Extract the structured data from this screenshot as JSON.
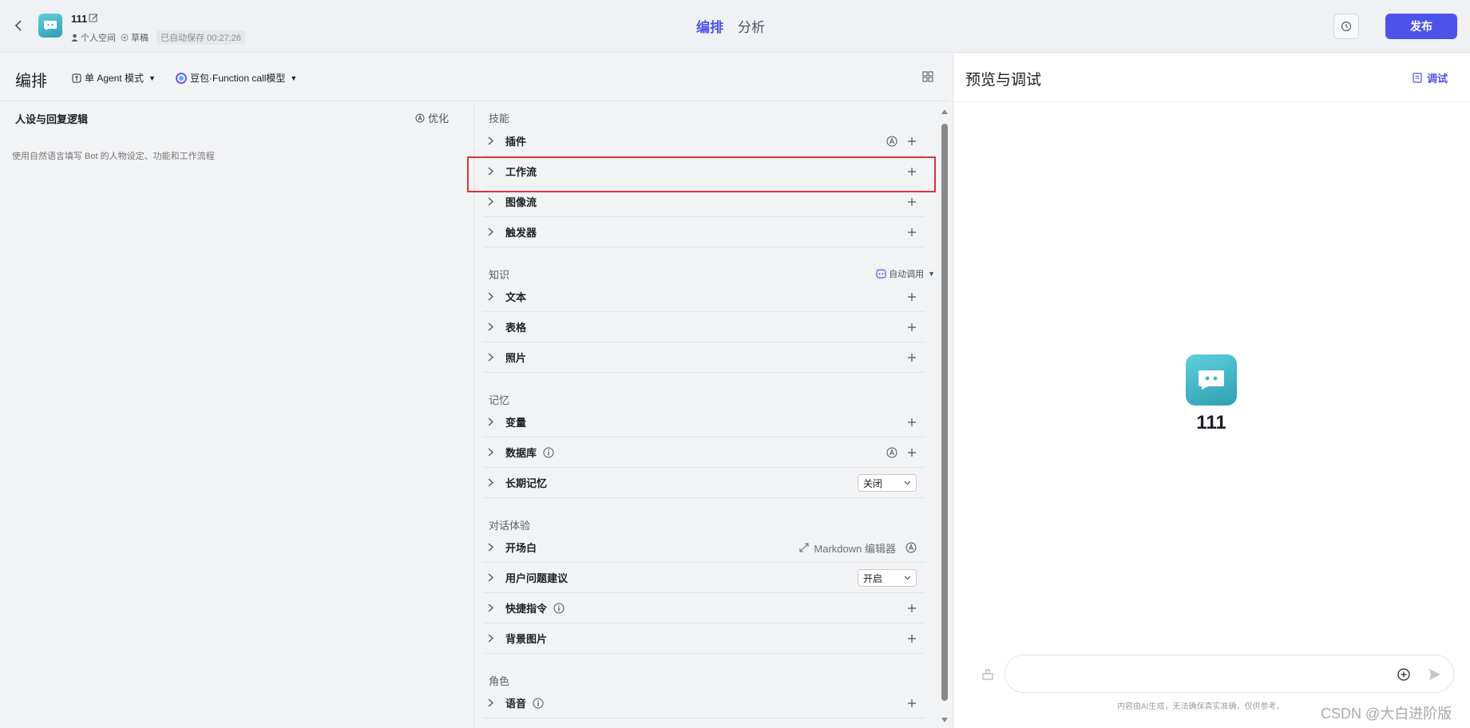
{
  "header": {
    "bot_name": "111",
    "space": "个人空间",
    "draft": "草稿",
    "autosave": "已自动保存 00:27:26",
    "tabs": [
      {
        "label": "编排",
        "active": true
      },
      {
        "label": "分析",
        "active": false
      }
    ],
    "publish_label": "发布"
  },
  "toolbar": {
    "title": "编排",
    "mode": "单 Agent 模式",
    "model": "豆包·Function call模型"
  },
  "prompt": {
    "title": "人设与回复逻辑",
    "optimize_label": "优化",
    "placeholder": "使用自然语言填写 Bot 的人物设定、功能和工作流程"
  },
  "skills": {
    "label": "技能",
    "items": [
      "插件",
      "工作流",
      "图像流",
      "触发器"
    ]
  },
  "knowledge": {
    "label": "知识",
    "auto_call": "自动调用",
    "items": [
      "文本",
      "表格",
      "照片"
    ]
  },
  "memory": {
    "label": "记忆",
    "items": [
      "变量",
      "数据库",
      "长期记忆"
    ],
    "long_term_value": "关闭"
  },
  "dialog": {
    "label": "对话体验",
    "items": [
      "开场白",
      "用户问题建议",
      "快捷指令",
      "背景图片"
    ],
    "md_editor": "Markdown 编辑器",
    "suggest_value": "开启"
  },
  "role": {
    "label": "角色",
    "items": [
      "语音"
    ]
  },
  "preview": {
    "title": "预览与调试",
    "debug_label": "调试",
    "bot_name": "111",
    "input_placeholder": "",
    "disclaimer": "内容由AI生成，无法确保真实准确，仅供参考。"
  },
  "watermark": "CSDN @大白进阶版",
  "colors": {
    "accent": "#4d53e8",
    "highlight": "#e0323a",
    "avatar": "#3fb6c6"
  }
}
